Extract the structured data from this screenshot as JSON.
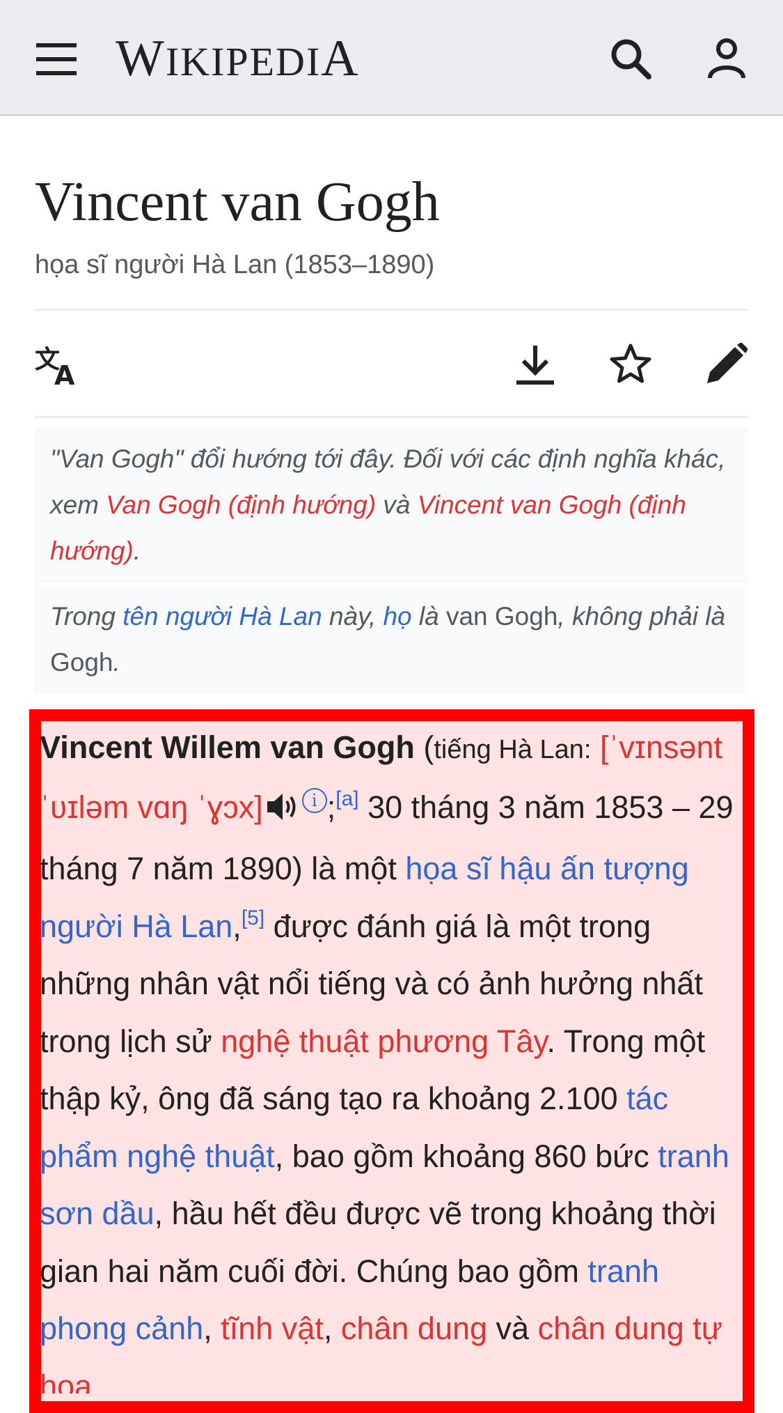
{
  "header": {
    "wordmark": {
      "first": "W",
      "middle": "IKIPEDI",
      "last": "A"
    },
    "menu_icon": "hamburger-menu-icon",
    "search_icon": "search-icon",
    "user_icon": "user-icon"
  },
  "article": {
    "title": "Vincent van Gogh",
    "subtitle": "họa sĩ người Hà Lan (1853–1890)"
  },
  "toolbar": {
    "language_icon": "translate-icon",
    "download_icon": "download-icon",
    "watch_icon": "star-icon",
    "edit_icon": "pencil-icon"
  },
  "hatnote1": {
    "t1": "\"Van Gogh\" đổi hướng tới đây. Đối với các định nghĩa khác, xem ",
    "link1": "Van Gogh (định hướng)",
    "t2": " và ",
    "link2": "Vincent van Gogh (định hướng)",
    "t3": "."
  },
  "hatnote2": {
    "t1": "Trong ",
    "link1": "tên người Hà Lan",
    "t2": " này, ",
    "link2": "họ",
    "t3": " là ",
    "name1": "van Gogh",
    "t4": ", không phải là ",
    "name2": "Gogh",
    "t5": "."
  },
  "lead": {
    "name": "Vincent Willem van Gogh",
    "open": " (",
    "lang": "tiếng Hà Lan:",
    "ipa": "[ˈvɪnsənt ˈʋɪləm vɑŋ ˈɣɔx]",
    "info": "i",
    "semi": ";",
    "ref_a": "[a]",
    "t1": " 30 tháng 3 năm 1853 – 29 tháng 7 năm 1890) là một ",
    "link1": "họa sĩ hậu ấn tượng người Hà Lan",
    "comma1": ",",
    "ref5": "[5]",
    "t2": " được đánh giá là một trong những nhân vật nổi tiếng và có ảnh hưởng nhất trong lịch sử ",
    "link2": "nghệ thuật phương Tây",
    "t3": ". Trong một thập kỷ, ông đã sáng tạo ra khoảng 2.100 ",
    "link3": "tác phẩm nghệ thuật",
    "t4": ", bao gồm khoảng 860 bức ",
    "link4": "tranh sơn dầu",
    "t5": ", hầu hết đều được vẽ trong khoảng thời gian hai năm cuối đời. Chúng bao gồm ",
    "link5": "tranh phong cảnh",
    "sep1": ", ",
    "link6": "tĩnh vật",
    "sep2": ", ",
    "link7": "chân dung",
    "t6": " và ",
    "link8": "chân dung tự họa"
  },
  "colors": {
    "link_blue": "#3366cc",
    "link_red": "#d33",
    "highlight_border": "#ff0000",
    "highlight_fill": "#ffe3e3",
    "header_bg": "#eaecf0"
  }
}
